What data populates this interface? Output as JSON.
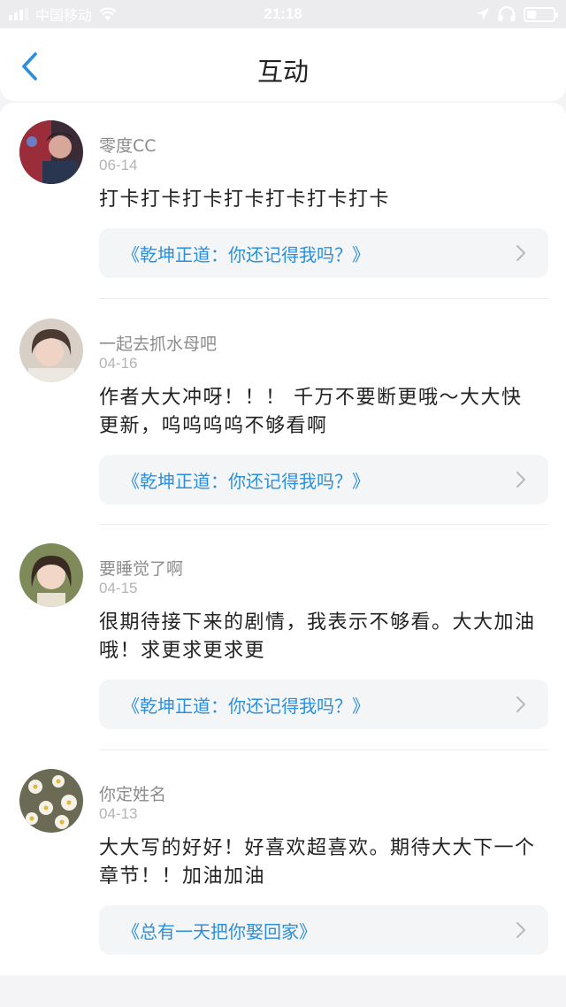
{
  "status_bar": {
    "carrier": "中国移动",
    "time": "21:18",
    "battery_level": 0.35
  },
  "nav": {
    "title": "互动",
    "back_icon": "chevron-left-icon"
  },
  "colors": {
    "accent": "#2b8fdc",
    "background": "#f4f4f6",
    "book_box": "#f4f5f7"
  },
  "comments": [
    {
      "username": "零度CC",
      "date": "06-14",
      "text": "打卡打卡打卡打卡打卡打卡打卡",
      "book": "《乾坤正道：你还记得我吗？》"
    },
    {
      "username": "一起去抓水母吧",
      "date": "04-16",
      "text": "作者大大冲呀！！！ 千万不要断更哦～大大快更新，呜呜呜呜不够看啊",
      "book": "《乾坤正道：你还记得我吗？》"
    },
    {
      "username": "要睡觉了啊",
      "date": "04-15",
      "text": "很期待接下来的剧情，我表示不够看。大大加油哦！求更求更求更",
      "book": "《乾坤正道：你还记得我吗？》"
    },
    {
      "username": "你定姓名",
      "date": "04-13",
      "text": "大大写的好好！好喜欢超喜欢。期待大大下一个章节！！加油加油",
      "book": "《总有一天把你娶回家》"
    }
  ]
}
